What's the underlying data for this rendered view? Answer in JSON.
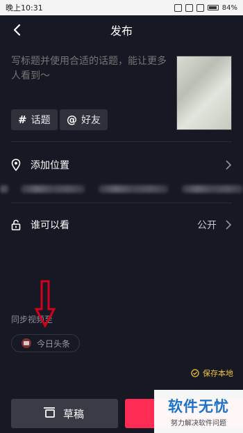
{
  "status": {
    "time": "晚上10:31",
    "battery": "84%"
  },
  "nav": {
    "title": "发布"
  },
  "post": {
    "placeholder": "写标题并使用合适的话题，能让更多人看到～",
    "topic_label": "话题",
    "friend_label": "好友"
  },
  "rows": {
    "location": "添加位置",
    "visibility": "谁可以看",
    "visibility_value": "公开"
  },
  "sync": {
    "label": "同步视频至",
    "toutiao": "今日头条"
  },
  "footer": {
    "save_local": "保存本地",
    "draft": "草稿"
  },
  "watermark": {
    "main": "软件无忧",
    "sub": "努力解决软件问题"
  },
  "colors": {
    "background": "#161823",
    "accent": "#fe2c55",
    "save_local": "#f2c230",
    "arrow": "#d0021b"
  },
  "icons": [
    "back-icon",
    "hash-icon",
    "at-icon",
    "location-pin-icon",
    "lock-icon",
    "chevron-right-icon",
    "toutiao-icon",
    "check-circle-icon",
    "draft-icon",
    "down-arrow-icon"
  ]
}
